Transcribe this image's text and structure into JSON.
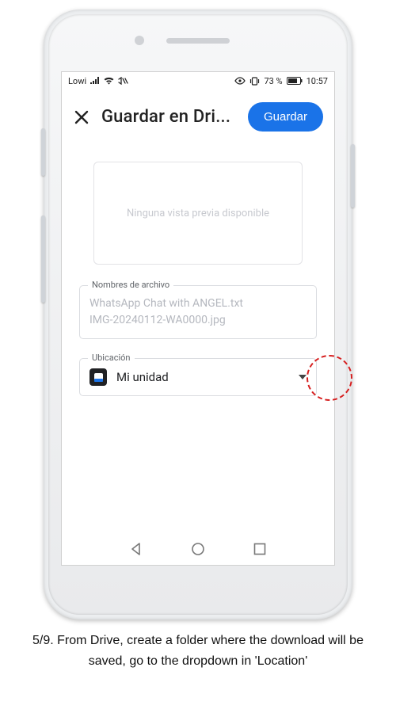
{
  "statusbar": {
    "carrier": "Lowi",
    "battery_pct": "73 %",
    "time": "10:57"
  },
  "header": {
    "title": "Guardar en Dri...",
    "save_label": "Guardar"
  },
  "preview": {
    "placeholder": "Ninguna vista previa disponible"
  },
  "filenames": {
    "legend": "Nombres de archivo",
    "line1": "WhatsApp Chat with ANGEL.txt",
    "line2": "IMG-20240112-WA0000.jpg"
  },
  "location": {
    "legend": "Ubicación",
    "value": "Mi unidad"
  },
  "caption": {
    "text": "5/9. From Drive, create a folder where the download will be saved, go to the dropdown in 'Location'"
  }
}
